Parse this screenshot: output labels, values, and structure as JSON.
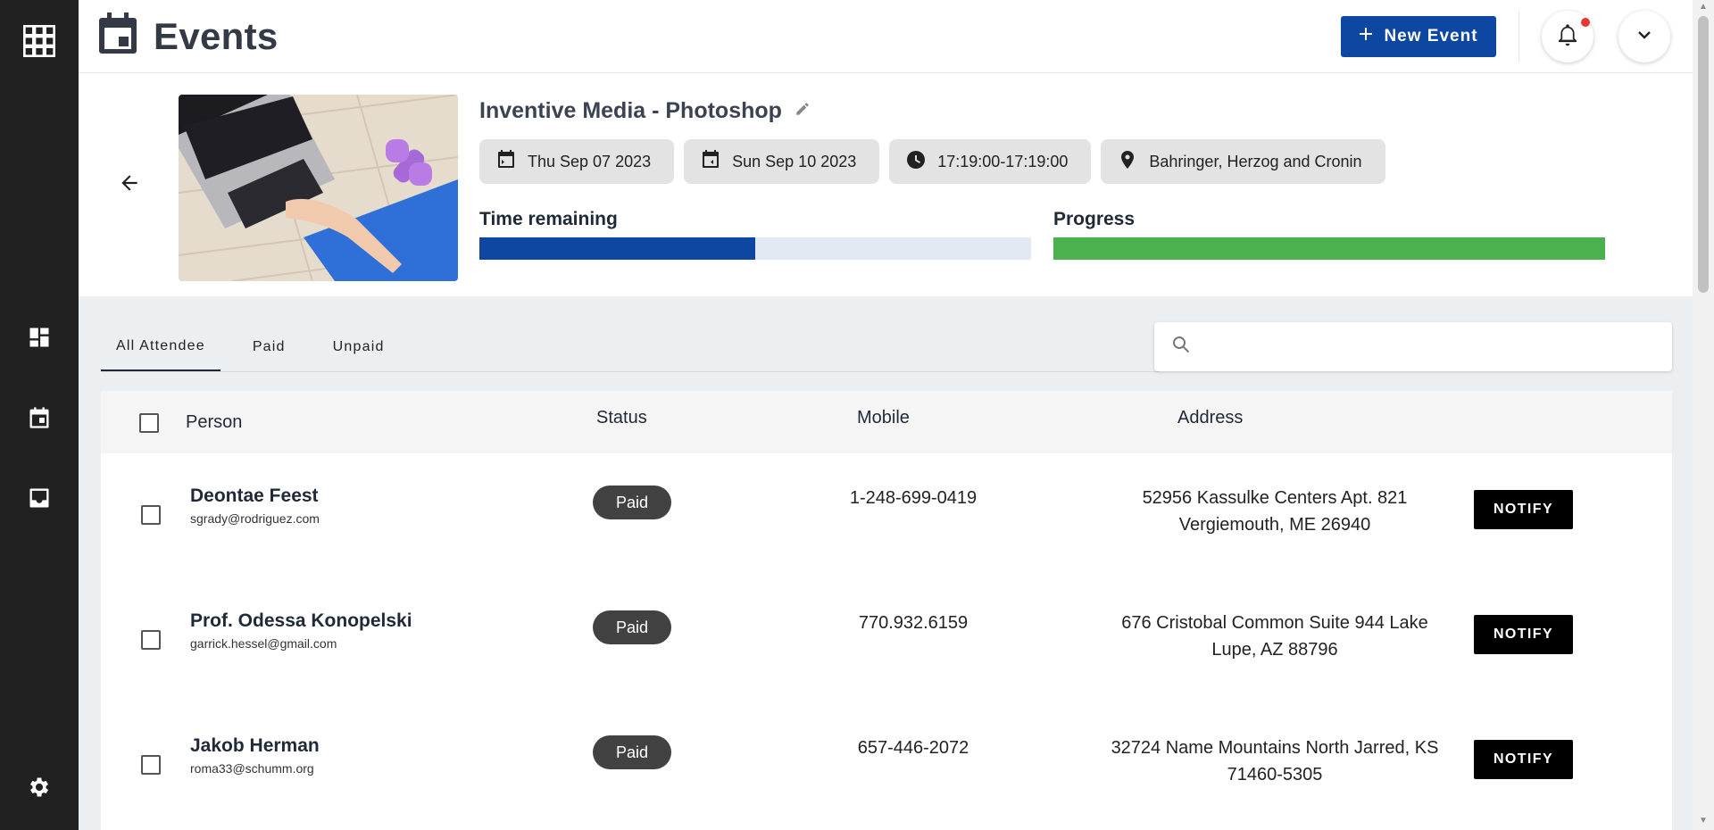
{
  "sidebar": {
    "icons": [
      "apps-grid-icon",
      "dashboard-icon",
      "calendar-event-icon",
      "inbox-icon",
      "settings-gear-icon"
    ]
  },
  "header": {
    "title": "Events",
    "new_event_label": "New Event"
  },
  "event": {
    "name": "Inventive Media - Photoshop",
    "start_date": "Thu Sep 07 2023",
    "end_date": "Sun Sep 10 2023",
    "time_range": "17:19:00-17:19:00",
    "location": "Bahringer, Herzog and Cronin",
    "time_remaining_label": "Time remaining",
    "time_remaining_fraction": 0.5,
    "progress_label": "Progress",
    "progress_fraction": 1.0
  },
  "tabs": [
    "All Attendee",
    "Paid",
    "Unpaid"
  ],
  "search": {
    "placeholder": ""
  },
  "table": {
    "headers": {
      "person": "Person",
      "status": "Status",
      "mobile": "Mobile",
      "address": "Address"
    },
    "rows": [
      {
        "name": "Deontae Feest",
        "email": "sgrady@rodriguez.com",
        "status": "Paid",
        "mobile": "1-248-699-0419",
        "address_line1": "52956 Kassulke Centers Apt. 821",
        "address_line2": "Vergiemouth, ME 26940",
        "action": "NOTIFY"
      },
      {
        "name": "Prof. Odessa Konopelski",
        "email": "garrick.hessel@gmail.com",
        "status": "Paid",
        "mobile": "770.932.6159",
        "address_line1": "676 Cristobal Common Suite 944 Lake",
        "address_line2": "Lupe, AZ 88796",
        "action": "NOTIFY"
      },
      {
        "name": "Jakob Herman",
        "email": "roma33@schumm.org",
        "status": "Paid",
        "mobile": "657-446-2072",
        "address_line1": "32724 Name Mountains North Jarred, KS",
        "address_line2": "71460-5305",
        "action": "NOTIFY"
      }
    ]
  },
  "colors": {
    "sidebar": "#212121",
    "primary": "#0d47a1",
    "progress": "#4caf50",
    "notification_dot": "#e53935"
  }
}
